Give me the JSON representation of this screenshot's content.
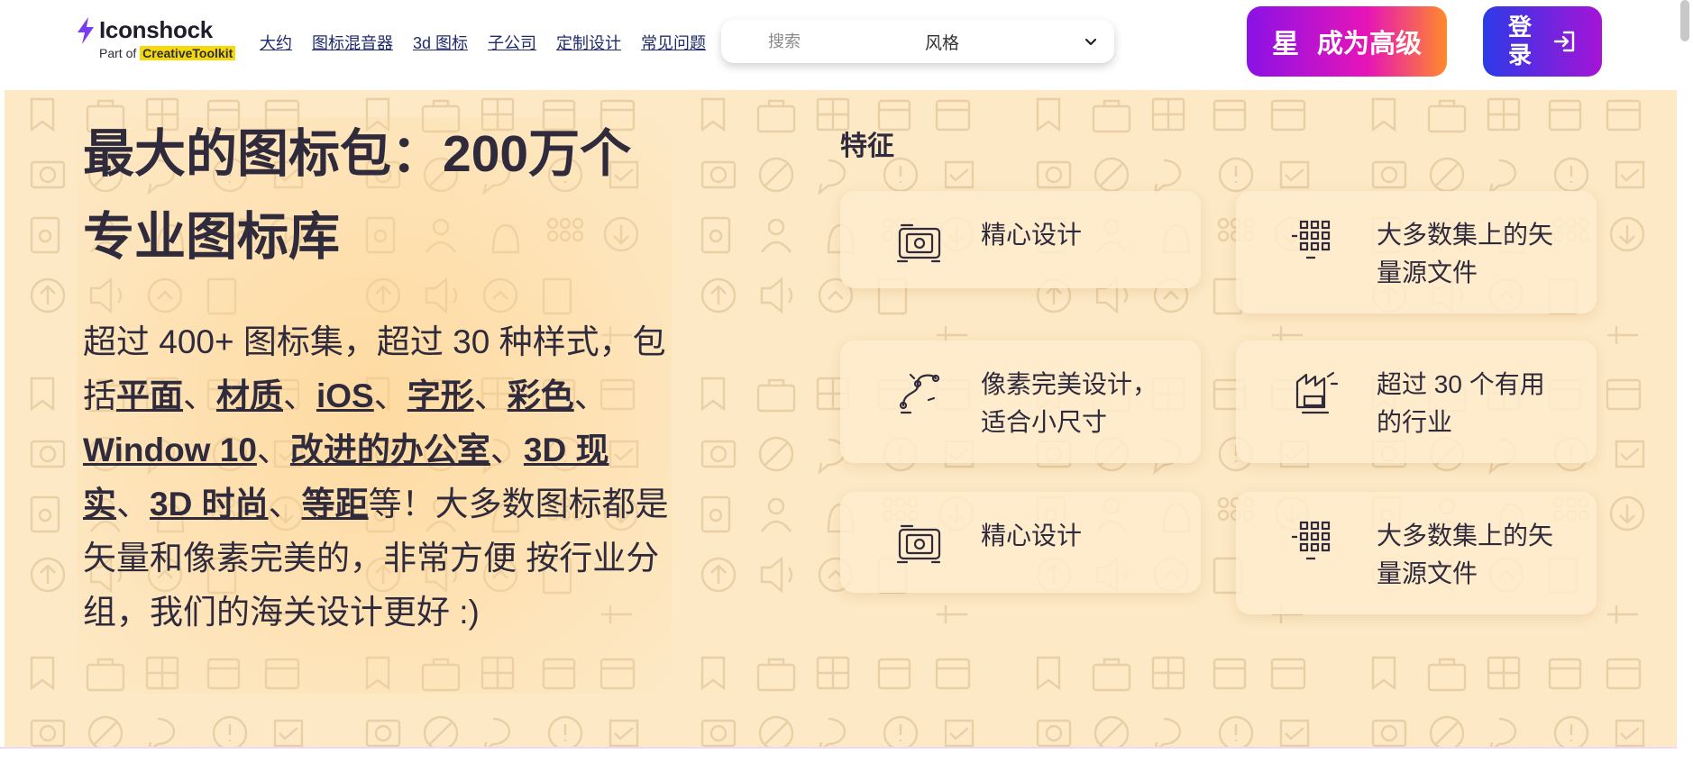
{
  "brand": {
    "name": "Iconshock",
    "sub_prefix": "Part of ",
    "sub_highlight": "CreativeToolkit",
    "accent": "#7a3cf0"
  },
  "nav": [
    "大约",
    "图标混音器",
    "3d 图标",
    "子公司",
    "定制设计",
    "常见问题"
  ],
  "search": {
    "placeholder": "搜索",
    "style_value": "风格"
  },
  "buttons": {
    "premium_star": "星",
    "premium": "成为高级",
    "login": "登录"
  },
  "hero": {
    "title": "最大的图标包：200万个专业图标库",
    "desc_parts": [
      "超过 400+ 图标集，超过 30 种样式，包括",
      "平面",
      "、",
      "材质",
      "、",
      "iOS",
      "、",
      "字形",
      "、",
      "彩色",
      "、",
      "Window 10",
      "、",
      "改进的办公室",
      "、",
      "3D 现实",
      "、",
      "3D 时尚",
      "、",
      "等距",
      "等！大多数图标都是矢量和像素完美的，非常方便 按行业分组，我们的海关设计更好 :)"
    ]
  },
  "features": {
    "title": "特征",
    "items": [
      {
        "label": "精心设计",
        "icon": "photo-frame-icon"
      },
      {
        "label": "大多数集上的矢量源文件",
        "icon": "vector-grid-icon"
      },
      {
        "label": "像素完美设计，适合小尺寸",
        "icon": "bezier-path-icon"
      },
      {
        "label": "超过 30 个有用的行业",
        "icon": "industry-icon"
      },
      {
        "label": "精心设计",
        "icon": "photo-frame-icon"
      },
      {
        "label": "大多数集上的矢量源文件",
        "icon": "vector-grid-icon"
      }
    ]
  },
  "colors": {
    "hero_bg": "#fde9c6",
    "text": "#2f2b3c",
    "premium_gradient": [
      "#8a12e6",
      "#e614b8",
      "#ff8a2a"
    ],
    "login_gradient": [
      "#2c3ae8",
      "#a514d6"
    ]
  }
}
